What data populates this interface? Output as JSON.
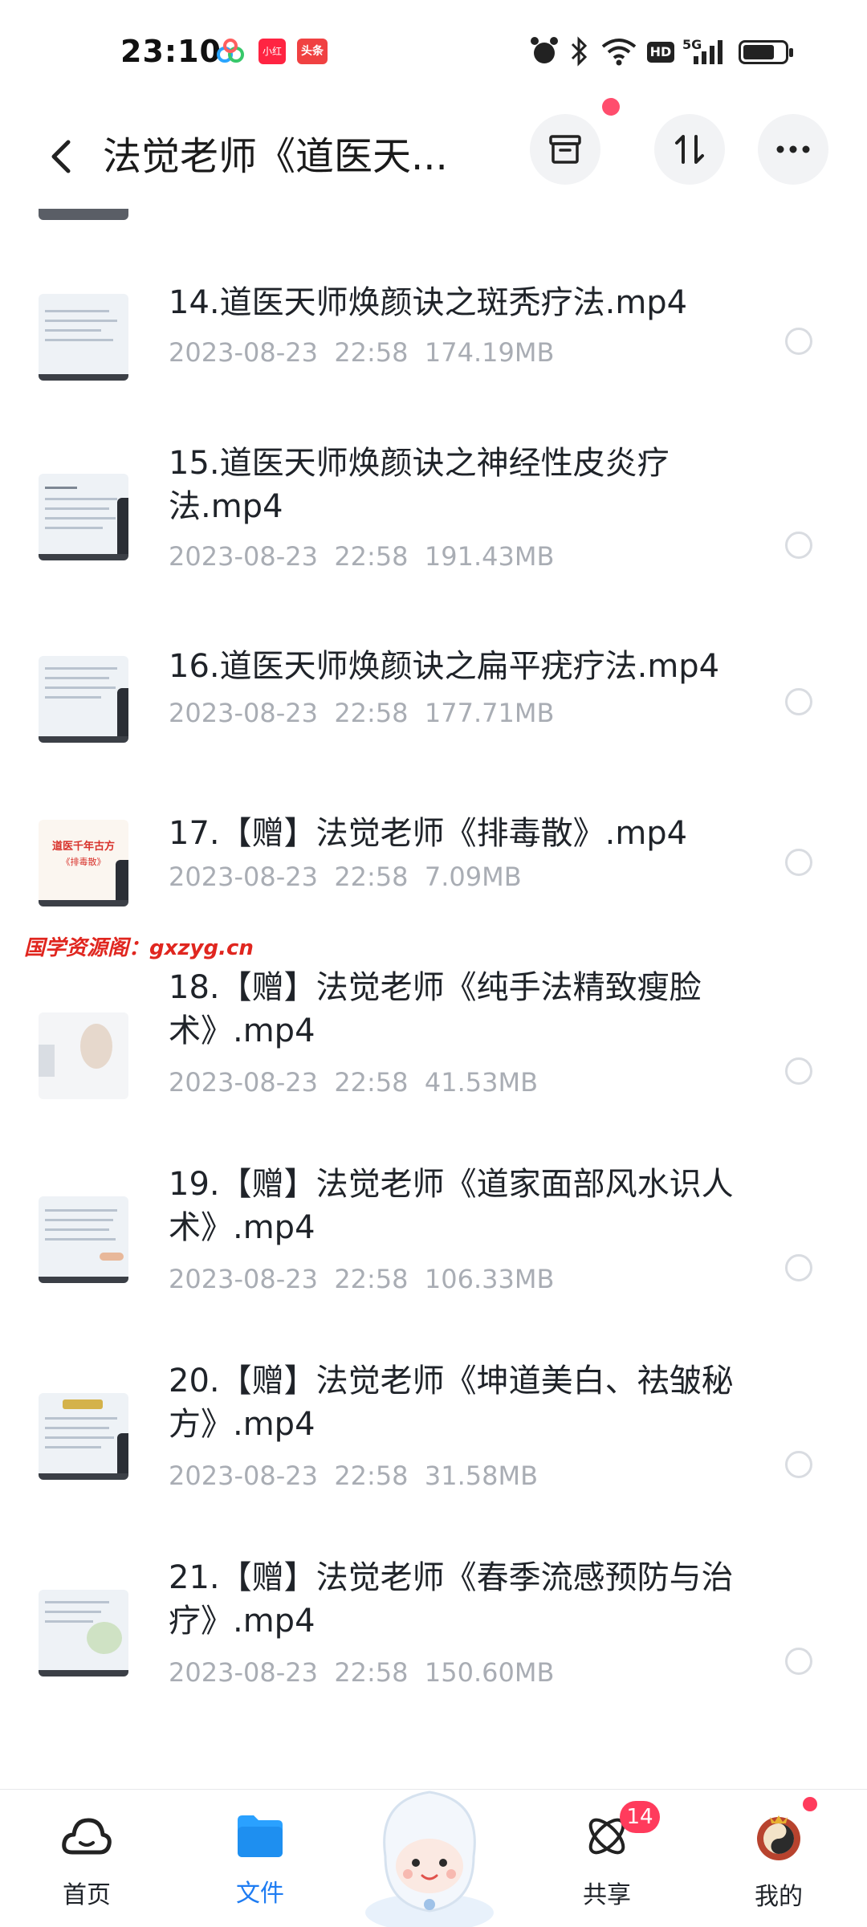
{
  "status_bar": {
    "time": "23:10",
    "apps": [
      "baidu-netdisk-icon",
      "小红书",
      "头条"
    ],
    "network": "5G",
    "hd": "HD",
    "battery_level": 0.75
  },
  "header": {
    "title": "法觉老师《道医天...",
    "back_icon": "chevron-left-icon",
    "buttons": [
      "archive-icon",
      "sort-icon",
      "more-icon"
    ]
  },
  "files": [
    {
      "name": "14.道医天师焕颜诀之斑秃疗法.mp4",
      "date": "2023-08-23  22:58",
      "size": "174.19MB"
    },
    {
      "name": "15.道医天师焕颜诀之神经性皮炎疗法.mp4",
      "date": "2023-08-23  22:58",
      "size": "191.43MB"
    },
    {
      "name": "16.道医天师焕颜诀之扁平疣疗法.mp4",
      "date": "2023-08-23  22:58",
      "size": "177.71MB"
    },
    {
      "name": "17.【赠】法觉老师《排毒散》.mp4",
      "date": "2023-08-23  22:58",
      "size": "7.09MB",
      "thumb_text": [
        "道医千年古方",
        "《排毒散》"
      ]
    },
    {
      "name": "18.【赠】法觉老师《纯手法精致瘦脸术》.mp4",
      "date": "2023-08-23  22:58",
      "size": "41.53MB"
    },
    {
      "name": "19.【赠】法觉老师《道家面部风水识人术》.mp4",
      "date": "2023-08-23  22:58",
      "size": "106.33MB"
    },
    {
      "name": "20.【赠】法觉老师《坤道美白、祛皱秘方》.mp4",
      "date": "2023-08-23  22:58",
      "size": "31.58MB"
    },
    {
      "name": "21.【赠】法觉老师《春季流感预防与治疗》.mp4",
      "date": "2023-08-23  22:58",
      "size": "150.60MB"
    }
  ],
  "watermark": "国学资源阁：gxzyg.cn",
  "nav": {
    "home": "首页",
    "files": "文件",
    "share": "共享",
    "share_badge": "14",
    "mine": "我的"
  },
  "colors": {
    "accent": "#1e7cf2",
    "badge": "#ff3b5c",
    "meta": "#a9adb4",
    "watermark": "#e0261f"
  }
}
